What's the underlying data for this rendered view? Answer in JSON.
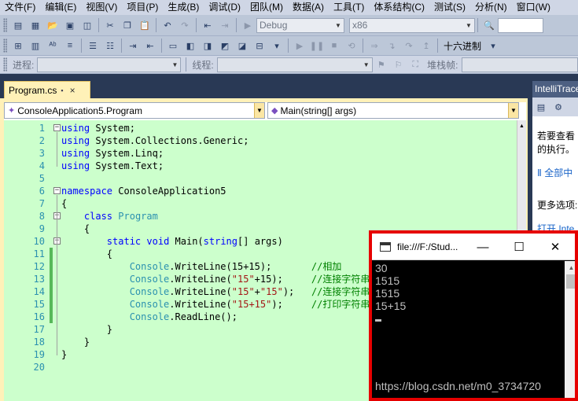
{
  "menu": [
    "文件(F)",
    "编辑(E)",
    "视图(V)",
    "项目(P)",
    "生成(B)",
    "调试(D)",
    "团队(M)",
    "数据(A)",
    "工具(T)",
    "体系结构(C)",
    "测试(S)",
    "分析(N)",
    "窗口(W)"
  ],
  "toolbar": {
    "config_combo": "Debug",
    "platform_combo": "x86",
    "hex_label": "十六进制",
    "process_label": "进程:",
    "thread_label": "线程:",
    "stackframe_label": "堆栈帧:"
  },
  "document": {
    "tab_title": "Program.cs",
    "tab_close": "×",
    "nav_class": "ConsoleApplication5.Program",
    "nav_method": "Main(string[] args)"
  },
  "code_lines": [
    {
      "n": "1",
      "tokens": [
        {
          "c": "kw",
          "t": "using"
        },
        {
          "c": "tx",
          "t": " System;"
        }
      ]
    },
    {
      "n": "2",
      "tokens": [
        {
          "c": "kw",
          "t": "using"
        },
        {
          "c": "tx",
          "t": " System.Collections.Generic;"
        }
      ]
    },
    {
      "n": "3",
      "tokens": [
        {
          "c": "kw",
          "t": "using"
        },
        {
          "c": "tx",
          "t": " System.Linq;"
        }
      ]
    },
    {
      "n": "4",
      "tokens": [
        {
          "c": "kw",
          "t": "using"
        },
        {
          "c": "tx",
          "t": " System.Text;"
        }
      ]
    },
    {
      "n": "5",
      "tokens": []
    },
    {
      "n": "6",
      "tokens": [
        {
          "c": "kw",
          "t": "namespace"
        },
        {
          "c": "tx",
          "t": " ConsoleApplication5"
        }
      ]
    },
    {
      "n": "7",
      "tokens": [
        {
          "c": "tx",
          "t": "{"
        }
      ]
    },
    {
      "n": "8",
      "tokens": [
        {
          "c": "tx",
          "t": "    "
        },
        {
          "c": "kw",
          "t": "class"
        },
        {
          "c": "tx",
          "t": " "
        },
        {
          "c": "ty",
          "t": "Program"
        }
      ]
    },
    {
      "n": "9",
      "tokens": [
        {
          "c": "tx",
          "t": "    {"
        }
      ]
    },
    {
      "n": "10",
      "tokens": [
        {
          "c": "tx",
          "t": "        "
        },
        {
          "c": "kw",
          "t": "static"
        },
        {
          "c": "tx",
          "t": " "
        },
        {
          "c": "kw",
          "t": "void"
        },
        {
          "c": "tx",
          "t": " Main("
        },
        {
          "c": "kw",
          "t": "string"
        },
        {
          "c": "tx",
          "t": "[] args)"
        }
      ]
    },
    {
      "n": "11",
      "tokens": [
        {
          "c": "tx",
          "t": "        {"
        }
      ]
    },
    {
      "n": "12",
      "tokens": [
        {
          "c": "tx",
          "t": "            "
        },
        {
          "c": "ty",
          "t": "Console"
        },
        {
          "c": "tx",
          "t": ".WriteLine(15+15);       "
        },
        {
          "c": "cm",
          "t": "//相加"
        }
      ]
    },
    {
      "n": "13",
      "tokens": [
        {
          "c": "tx",
          "t": "            "
        },
        {
          "c": "ty",
          "t": "Console"
        },
        {
          "c": "tx",
          "t": ".WriteLine("
        },
        {
          "c": "st",
          "t": "\"15\""
        },
        {
          "c": "tx",
          "t": "+15);     "
        },
        {
          "c": "cm",
          "t": "//连接字符串"
        }
      ]
    },
    {
      "n": "14",
      "tokens": [
        {
          "c": "tx",
          "t": "            "
        },
        {
          "c": "ty",
          "t": "Console"
        },
        {
          "c": "tx",
          "t": ".WriteLine("
        },
        {
          "c": "st",
          "t": "\"15\""
        },
        {
          "c": "tx",
          "t": "+"
        },
        {
          "c": "st",
          "t": "\"15\""
        },
        {
          "c": "tx",
          "t": ");   "
        },
        {
          "c": "cm",
          "t": "//连接字符串"
        }
      ]
    },
    {
      "n": "15",
      "tokens": [
        {
          "c": "tx",
          "t": "            "
        },
        {
          "c": "ty",
          "t": "Console"
        },
        {
          "c": "tx",
          "t": ".WriteLine("
        },
        {
          "c": "st",
          "t": "\"15+15\""
        },
        {
          "c": "tx",
          "t": ");     "
        },
        {
          "c": "cm",
          "t": "//打印字符串"
        }
      ]
    },
    {
      "n": "16",
      "tokens": [
        {
          "c": "tx",
          "t": "            "
        },
        {
          "c": "ty",
          "t": "Console"
        },
        {
          "c": "tx",
          "t": ".ReadLine();"
        }
      ]
    },
    {
      "n": "17",
      "tokens": [
        {
          "c": "tx",
          "t": "        }"
        }
      ]
    },
    {
      "n": "18",
      "tokens": [
        {
          "c": "tx",
          "t": "    }"
        }
      ]
    },
    {
      "n": "19",
      "tokens": [
        {
          "c": "tx",
          "t": "}"
        }
      ]
    },
    {
      "n": "20",
      "tokens": []
    }
  ],
  "right_panel": {
    "title": "IntelliTrace",
    "text1": "若要查看",
    "text2": "的执行。",
    "link1": "全部中",
    "more_label": "更多选项:",
    "link2": "打开 Inte"
  },
  "console": {
    "title": "file:///F:/Stud...",
    "minimize": "—",
    "maximize": "☐",
    "close": "✕",
    "output": [
      "30",
      "1515",
      "1515",
      "15+15"
    ],
    "watermark": "https://blog.csdn.net/m0_3734720"
  }
}
